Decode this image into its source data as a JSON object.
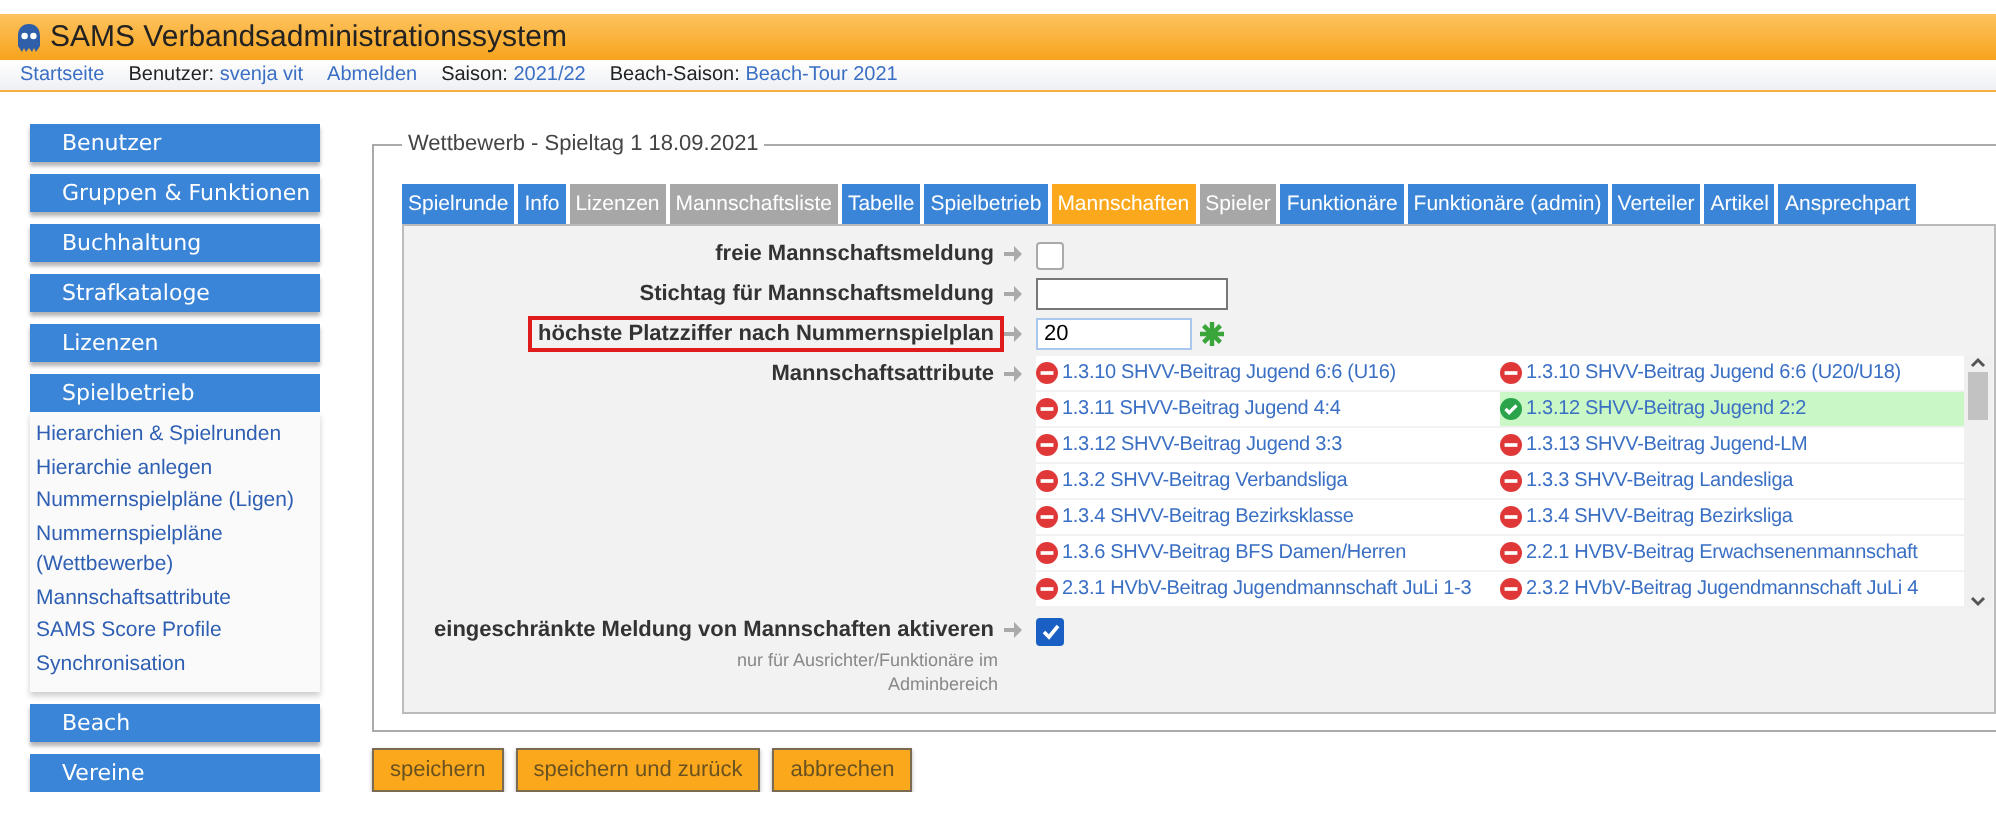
{
  "header": {
    "title": "SAMS Verbandsadministrationssystem"
  },
  "nav": [
    {
      "kind": "link",
      "text": "Startseite"
    },
    {
      "kind": "pair",
      "label": "Benutzer:",
      "value": "svenja vit"
    },
    {
      "kind": "link",
      "text": "Abmelden"
    },
    {
      "kind": "pair",
      "label": "Saison:",
      "value": "2021/22"
    },
    {
      "kind": "pair",
      "label": "Beach-Saison:",
      "value": "Beach-Tour 2021"
    }
  ],
  "sidebar": {
    "items": [
      {
        "label": "Benutzer",
        "expanded": false
      },
      {
        "label": "Gruppen & Funktionen",
        "expanded": false
      },
      {
        "label": "Buchhaltung",
        "expanded": false
      },
      {
        "label": "Strafkataloge",
        "expanded": false
      },
      {
        "label": "Lizenzen",
        "expanded": false
      },
      {
        "label": "Spielbetrieb",
        "expanded": true,
        "children": [
          "Hierarchien & Spielrunden",
          "Hierarchie anlegen",
          "Nummernspielpläne (Ligen)",
          "Nummernspielpläne (Wettbewerbe)",
          "Mannschaftsattribute",
          "SAMS Score Profile",
          "Synchronisation"
        ]
      },
      {
        "label": "Beach",
        "expanded": false
      },
      {
        "label": "Vereine",
        "expanded": false
      }
    ]
  },
  "panel": {
    "legend": "Wettbewerb - Spieltag 1 18.09.2021",
    "tabs": [
      {
        "label": "Spielrunde",
        "selected": false,
        "disabled": false
      },
      {
        "label": "Info",
        "selected": false,
        "disabled": false
      },
      {
        "label": "Lizenzen",
        "selected": false,
        "disabled": true
      },
      {
        "label": "Mannschaftsliste",
        "selected": false,
        "disabled": true
      },
      {
        "label": "Tabelle",
        "selected": false,
        "disabled": false
      },
      {
        "label": "Spielbetrieb",
        "selected": false,
        "disabled": false
      },
      {
        "label": "Mannschaften",
        "selected": true,
        "disabled": false
      },
      {
        "label": "Spieler",
        "selected": false,
        "disabled": true
      },
      {
        "label": "Funktionäre",
        "selected": false,
        "disabled": false
      },
      {
        "label": "Funktionäre (admin)",
        "selected": false,
        "disabled": false
      },
      {
        "label": "Verteiler",
        "selected": false,
        "disabled": false
      },
      {
        "label": "Artikel",
        "selected": false,
        "disabled": false
      },
      {
        "label": "Ansprechpart",
        "selected": false,
        "disabled": false
      }
    ],
    "fields": [
      {
        "kind": "checkbox",
        "label": "freie Mannschaftsmeldung",
        "checked": false,
        "highlighted": false
      },
      {
        "kind": "text",
        "label": "Stichtag für Mannschaftsmeldung",
        "highlighted": false,
        "required": false
      },
      {
        "kind": "text",
        "label": "höchste Platzziffer nach Nummernspielplan",
        "value": "20",
        "highlighted": true,
        "required": true
      },
      {
        "kind": "attributes",
        "label": "Mannschaftsattribute",
        "highlighted": false,
        "items": [
          {
            "text": "1.3.10 SHVV-Beitrag Jugend 6:6 (U16)",
            "selected": false
          },
          {
            "text": "1.3.10 SHVV-Beitrag Jugend 6:6 (U20/U18)",
            "selected": false
          },
          {
            "text": "1.3.11 SHVV-Beitrag Jugend 4:4",
            "selected": false
          },
          {
            "text": "1.3.12 SHVV-Beitrag Jugend 2:2",
            "selected": true
          },
          {
            "text": "1.3.12 SHVV-Beitrag Jugend 3:3",
            "selected": false
          },
          {
            "text": "1.3.13 SHVV-Beitrag Jugend-LM",
            "selected": false
          },
          {
            "text": "1.3.2 SHVV-Beitrag Verbandsliga",
            "selected": false
          },
          {
            "text": "1.3.3 SHVV-Beitrag Landesliga",
            "selected": false
          },
          {
            "text": "1.3.4 SHVV-Beitrag Bezirksklasse",
            "selected": false
          },
          {
            "text": "1.3.4 SHVV-Beitrag Bezirksliga",
            "selected": false
          },
          {
            "text": "1.3.6 SHVV-Beitrag BFS Damen/Herren",
            "selected": false
          },
          {
            "text": "2.2.1 HVBV-Beitrag Erwachsenenmannschaft",
            "selected": false
          },
          {
            "text": "2.3.1 HVbV-Beitrag Jugendmannschaft JuLi 1-3",
            "selected": false
          },
          {
            "text": "2.3.2 HVbV-Beitrag Jugendmannschaft JuLi 4",
            "selected": false
          }
        ]
      },
      {
        "kind": "checkbox",
        "label": "eingeschränkte Meldung von Mannschaften aktiveren",
        "note": "nur für Ausrichter/Funktionäre im Adminbereich",
        "checked": true,
        "highlighted": false
      }
    ],
    "buttons": [
      "speichern",
      "speichern und zurück",
      "abbrechen"
    ]
  }
}
